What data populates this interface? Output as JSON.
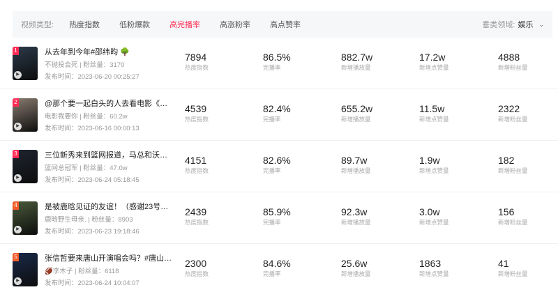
{
  "filter": {
    "label": "视频类型:",
    "tabs": [
      "热度指数",
      "低粉爆款",
      "高完播率",
      "高涨粉率",
      "高点赞率"
    ],
    "active": 2,
    "vertical_label": "垂类领域:",
    "vertical_value": "娱乐"
  },
  "stat_labels": [
    "热度指数",
    "完播率",
    "新增播放量",
    "新增点赞量",
    "新增粉丝量"
  ],
  "rows": [
    {
      "rank": "1",
      "title": "从去年到今年#邵纬昀 🌳",
      "author": "不抛投会死 | 粉丝量：3170",
      "time": "发布时间：2023-06-20 00:25:27",
      "heat": "7894",
      "completion": "86.5%",
      "plays": "882.7w",
      "likes": "17.2w",
      "fans": "4888",
      "thumb_color": "#2b3a4a"
    },
    {
      "rank": "2",
      "title": "@那个要一起白头的人去看电影《我...",
      "author": "电影我要你 | 粉丝量：60.2w",
      "time": "发布时间：2023-06-16 00:00:13",
      "heat": "4539",
      "completion": "82.4%",
      "plays": "655.2w",
      "likes": "11.5w",
      "fans": "2322",
      "thumb_color": "#8a7c70"
    },
    {
      "rank": "3",
      "title": "三位新秀来到篮网报道，马总和沃恩...",
      "author": "篮网总冠军 | 粉丝量：47.0w",
      "time": "发布时间：2023-06-24 05:18:45",
      "heat": "4151",
      "completion": "82.6%",
      "plays": "89.7w",
      "likes": "1.9w",
      "fans": "182",
      "thumb_color": "#1e2430"
    },
    {
      "rank": "4",
      "title": "是被鹿晗见证的友谊！（感谢23号我...",
      "author": "鹿晗野生母亲. | 粉丝量：8903",
      "time": "发布时间：2023-06-23 19:18:46",
      "heat": "2439",
      "completion": "85.9%",
      "plays": "92.3w",
      "likes": "3.0w",
      "fans": "156",
      "thumb_color": "#4a5a3a"
    },
    {
      "rank": "5",
      "title": "张信哲要来唐山开演唱会吗？#唐山#...",
      "author": "🏈李木子 | 粉丝量：6118",
      "time": "发布时间：2023-06-24 10:04:07",
      "heat": "2300",
      "completion": "84.6%",
      "plays": "25.6w",
      "likes": "1863",
      "fans": "41",
      "thumb_color": "#1a2a4a"
    }
  ]
}
